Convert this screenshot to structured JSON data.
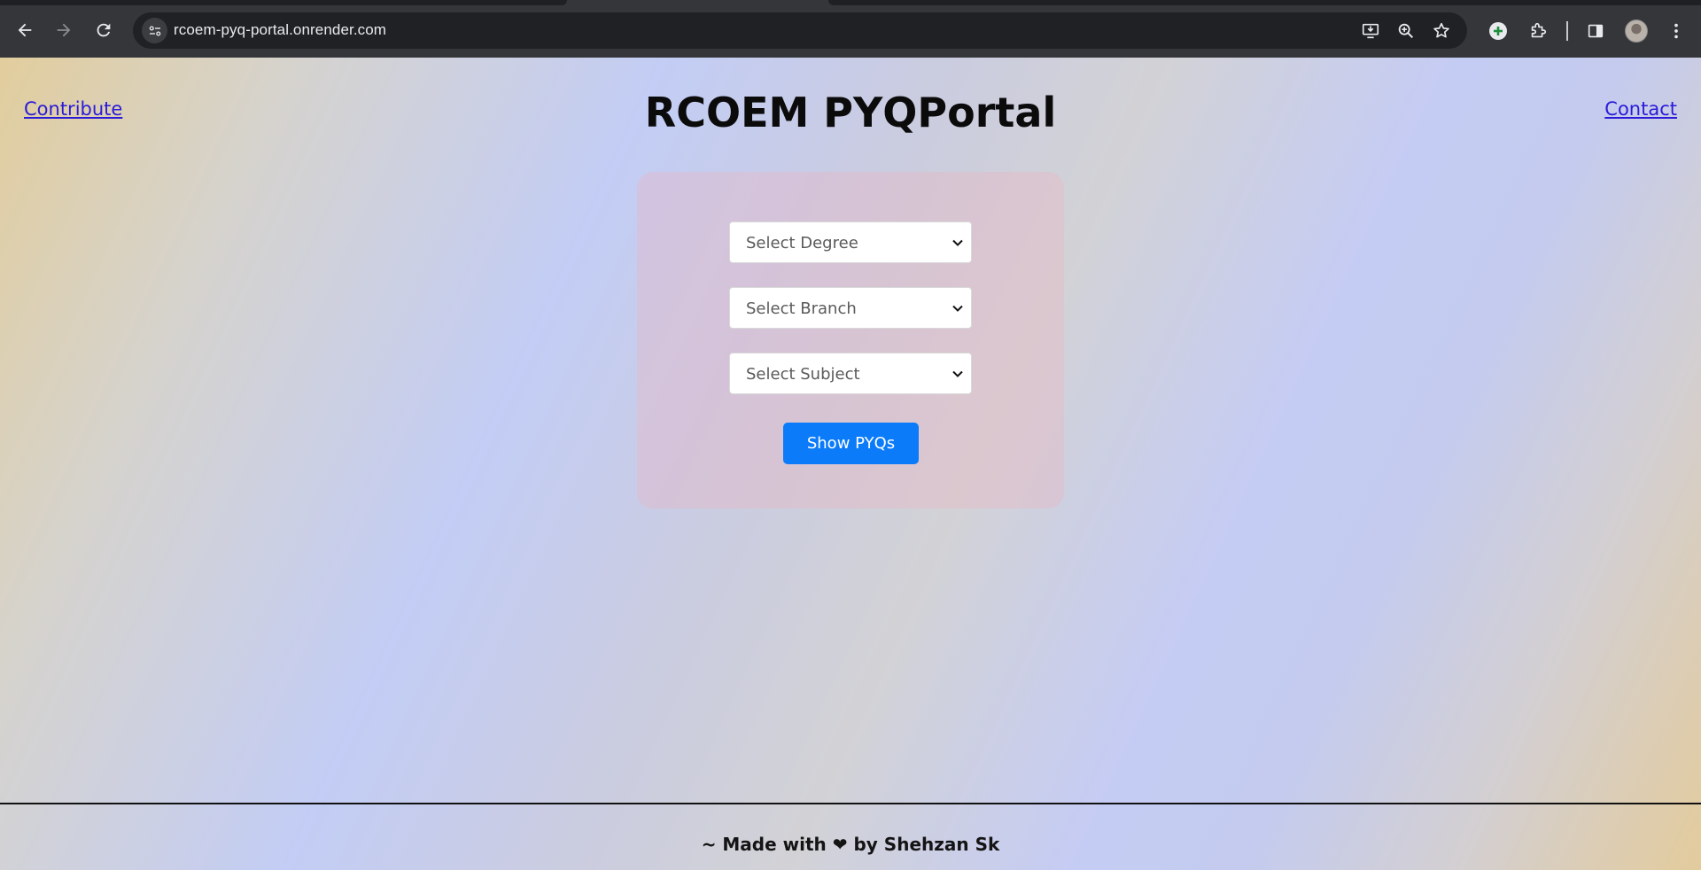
{
  "browser": {
    "url": "rcoem-pyq-portal.onrender.com",
    "icons": [
      "back-arrow-icon",
      "forward-arrow-icon",
      "reload-icon",
      "site-info-icon",
      "install-app-icon",
      "zoom-icon",
      "bookmark-star-icon",
      "extension-plus-icon",
      "extensions-puzzle-icon",
      "side-panel-icon",
      "profile-avatar",
      "kebab-menu-icon"
    ]
  },
  "header": {
    "title": "RCOEM PYQPortal",
    "contribute_link": "Contribute",
    "contact_link": "Contact"
  },
  "form": {
    "degree": {
      "selected": "Select Degree"
    },
    "branch": {
      "selected": "Select Branch"
    },
    "subject": {
      "selected": "Select Subject"
    },
    "submit_label": "Show PYQs"
  },
  "footer": {
    "prefix": "~ Made with",
    "heart": "❤",
    "suffix": "by Shehzan Sk"
  },
  "colors": {
    "accent_button": "#0b7bfa",
    "link": "#2a1bd9"
  }
}
